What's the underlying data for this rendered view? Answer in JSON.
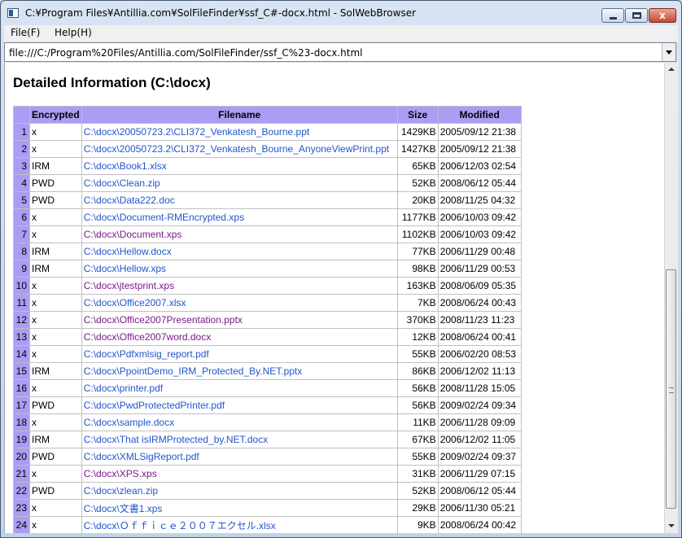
{
  "window": {
    "title": "C:¥Program Files¥Antillia.com¥SolFileFinder¥ssf_C#-docx.html - SolWebBrowser",
    "close_glyph": "x"
  },
  "menu": [
    {
      "label": "File(F)"
    },
    {
      "label": "Help(H)"
    }
  ],
  "address": {
    "value": "file:///C:/Program%20Files/Antillia.com/SolFileFinder/ssf_C%23-docx.html"
  },
  "page": {
    "title": "Detailed Information (C:\\docx)",
    "columns": [
      "",
      "Encrypted",
      "Filename",
      "Size",
      "Modified"
    ],
    "rows": [
      {
        "num": "1",
        "enc": "x",
        "file": "C:\\docx\\20050723.2\\CLI372_Venkatesh_Bourne.ppt",
        "size": "1429KB",
        "mod": "2005/09/12 21:38",
        "visited": false
      },
      {
        "num": "2",
        "enc": "x",
        "file": "C:\\docx\\20050723.2\\CLI372_Venkatesh_Bourne_AnyoneViewPrint.ppt",
        "size": "1427KB",
        "mod": "2005/09/12 21:38",
        "visited": false
      },
      {
        "num": "3",
        "enc": "IRM",
        "file": "C:\\docx\\Book1.xlsx",
        "size": "65KB",
        "mod": "2006/12/03 02:54",
        "visited": false
      },
      {
        "num": "4",
        "enc": "PWD",
        "file": "C:\\docx\\Clean.zip",
        "size": "52KB",
        "mod": "2008/06/12 05:44",
        "visited": false
      },
      {
        "num": "5",
        "enc": "PWD",
        "file": "C:\\docx\\Data222.doc",
        "size": "20KB",
        "mod": "2008/11/25 04:32",
        "visited": false
      },
      {
        "num": "6",
        "enc": "x",
        "file": "C:\\docx\\Document-RMEncrypted.xps",
        "size": "1177KB",
        "mod": "2006/10/03 09:42",
        "visited": false
      },
      {
        "num": "7",
        "enc": "x",
        "file": "C:\\docx\\Document.xps",
        "size": "1102KB",
        "mod": "2006/10/03 09:42",
        "visited": true
      },
      {
        "num": "8",
        "enc": "IRM",
        "file": "C:\\docx\\Hellow.docx",
        "size": "77KB",
        "mod": "2006/11/29 00:48",
        "visited": false
      },
      {
        "num": "9",
        "enc": "IRM",
        "file": "C:\\docx\\Hellow.xps",
        "size": "98KB",
        "mod": "2006/11/29 00:53",
        "visited": false
      },
      {
        "num": "10",
        "enc": "x",
        "file": "C:\\docx\\jtestprint.xps",
        "size": "163KB",
        "mod": "2008/06/09 05:35",
        "visited": true
      },
      {
        "num": "11",
        "enc": "x",
        "file": "C:\\docx\\Office2007.xlsx",
        "size": "7KB",
        "mod": "2008/06/24 00:43",
        "visited": false
      },
      {
        "num": "12",
        "enc": "x",
        "file": "C:\\docx\\Office2007Presentation.pptx",
        "size": "370KB",
        "mod": "2008/11/23 11:23",
        "visited": true
      },
      {
        "num": "13",
        "enc": "x",
        "file": "C:\\docx\\Office2007word.docx",
        "size": "12KB",
        "mod": "2008/06/24 00:41",
        "visited": true
      },
      {
        "num": "14",
        "enc": "x",
        "file": "C:\\docx\\Pdfxmlsig_report.pdf",
        "size": "55KB",
        "mod": "2006/02/20 08:53",
        "visited": false
      },
      {
        "num": "15",
        "enc": "IRM",
        "file": "C:\\docx\\PpointDemo_IRM_Protected_By.NET.pptx",
        "size": "86KB",
        "mod": "2006/12/02 11:13",
        "visited": false
      },
      {
        "num": "16",
        "enc": "x",
        "file": "C:\\docx\\printer.pdf",
        "size": "56KB",
        "mod": "2008/11/28 15:05",
        "visited": false
      },
      {
        "num": "17",
        "enc": "PWD",
        "file": "C:\\docx\\PwdProtectedPrinter.pdf",
        "size": "56KB",
        "mod": "2009/02/24 09:34",
        "visited": false
      },
      {
        "num": "18",
        "enc": "x",
        "file": "C:\\docx\\sample.docx",
        "size": "11KB",
        "mod": "2006/11/28 09:09",
        "visited": false
      },
      {
        "num": "19",
        "enc": "IRM",
        "file": "C:\\docx\\That isIRMProtected_by.NET.docx",
        "size": "67KB",
        "mod": "2006/12/02 11:05",
        "visited": false
      },
      {
        "num": "20",
        "enc": "PWD",
        "file": "C:\\docx\\XMLSigReport.pdf",
        "size": "55KB",
        "mod": "2009/02/24 09:37",
        "visited": false
      },
      {
        "num": "21",
        "enc": "x",
        "file": "C:\\docx\\XPS.xps",
        "size": "31KB",
        "mod": "2006/11/29 07:15",
        "visited": true
      },
      {
        "num": "22",
        "enc": "PWD",
        "file": "C:\\docx\\zlean.zip",
        "size": "52KB",
        "mod": "2008/06/12 05:44",
        "visited": false
      },
      {
        "num": "23",
        "enc": "x",
        "file": "C:\\docx\\文書1.xps",
        "size": "29KB",
        "mod": "2006/11/30 05:21",
        "visited": false
      },
      {
        "num": "24",
        "enc": "x",
        "file": "C:\\docx\\Ｏｆｆｉｃｅ２００７エクセル.xlsx",
        "size": "9KB",
        "mod": "2008/06/24 00:42",
        "visited": false
      }
    ]
  },
  "colors": {
    "header_bg": "#ab9cf4",
    "link": "#2255cc",
    "visited_link": "#7a1a88"
  }
}
